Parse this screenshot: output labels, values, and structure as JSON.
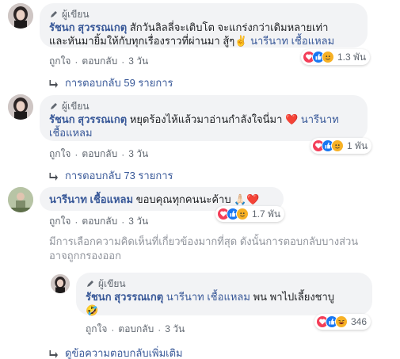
{
  "comments": [
    {
      "author_badge": "ผู้เขียน",
      "author": "รัชนก สุวรรณเกตุ",
      "text": "สักวันลิลลี่จะเติบโต จะแกร่งกว่าเดิมหลายเท่าและหันมายิ้มให้กับทุกเรื่องราวที่ผ่านมา สู้ๆ✌️",
      "text_line1": "สักวันลิลลี่จะเติบโต จะแกร่งกว่าเดิมหลายเท่า",
      "text_line2": "และหันมายิ้มให้กับทุกเรื่องราวที่ผ่านมา สู้ๆ✌️",
      "tag": "นารีนาท เชื้อแหลม",
      "reaction_count": "1.3 พัน",
      "like_label": "ถูกใจ",
      "reply_label": "ตอบกลับ",
      "time": "3 วัน",
      "replies_link": "การตอบกลับ 59 รายการ"
    },
    {
      "author_badge": "ผู้เขียน",
      "author": "รัชนก สุวรรณเกตุ",
      "text": "หยุดร้องไห้แล้วมาอ่านกำลังใจนี่มา ❤️",
      "tag_line1": "นารีนาท",
      "tag_line2": "เชื้อแหลม",
      "reaction_count": "1 พัน",
      "like_label": "ถูกใจ",
      "reply_label": "ตอบกลับ",
      "time": "3 วัน",
      "replies_link": "การตอบกลับ 73 รายการ"
    },
    {
      "author": "นารีนาท เชื้อแหลม",
      "text": "ขอบคุณทุกคนนะค้าบ 🙏🏻❤️",
      "reaction_count": "1.7 พัน",
      "like_label": "ถูกใจ",
      "reply_label": "ตอบกลับ",
      "time": "3 วัน"
    }
  ],
  "notice_line1": "มีการเลือกความคิดเห็นที่เกี่ยวข้องมากที่สุด ดังนั้นการตอบกลับบางส่วน",
  "notice_line2": "อาจถูกกรองออก",
  "reply": {
    "author_badge": "ผู้เขียน",
    "author": "รัชนก สุวรรณเกตุ",
    "tag": "นารีนาท เชื้อแหลม",
    "text": "พน พาไปเลี้ยงชาบู",
    "emoji": "🤣",
    "reaction_count": "346",
    "like_label": "ถูกใจ",
    "reply_label": "ตอบกลับ",
    "time": "3 วัน"
  },
  "more_replies_link": "ดูข้อความตอบกลับเพิ่มเติม",
  "icons": {
    "author_badge": "pencil-icon",
    "reply_arrow": "reply-arrow-icon",
    "reactions": [
      "love-reaction-icon",
      "like-reaction-icon",
      "care-reaction-icon",
      "haha-reaction-icon"
    ]
  },
  "colors": {
    "link": "#385898",
    "bubble": "#f2f3f5",
    "meta": "#606770",
    "love": "#f33e58",
    "like": "#1877f2"
  }
}
